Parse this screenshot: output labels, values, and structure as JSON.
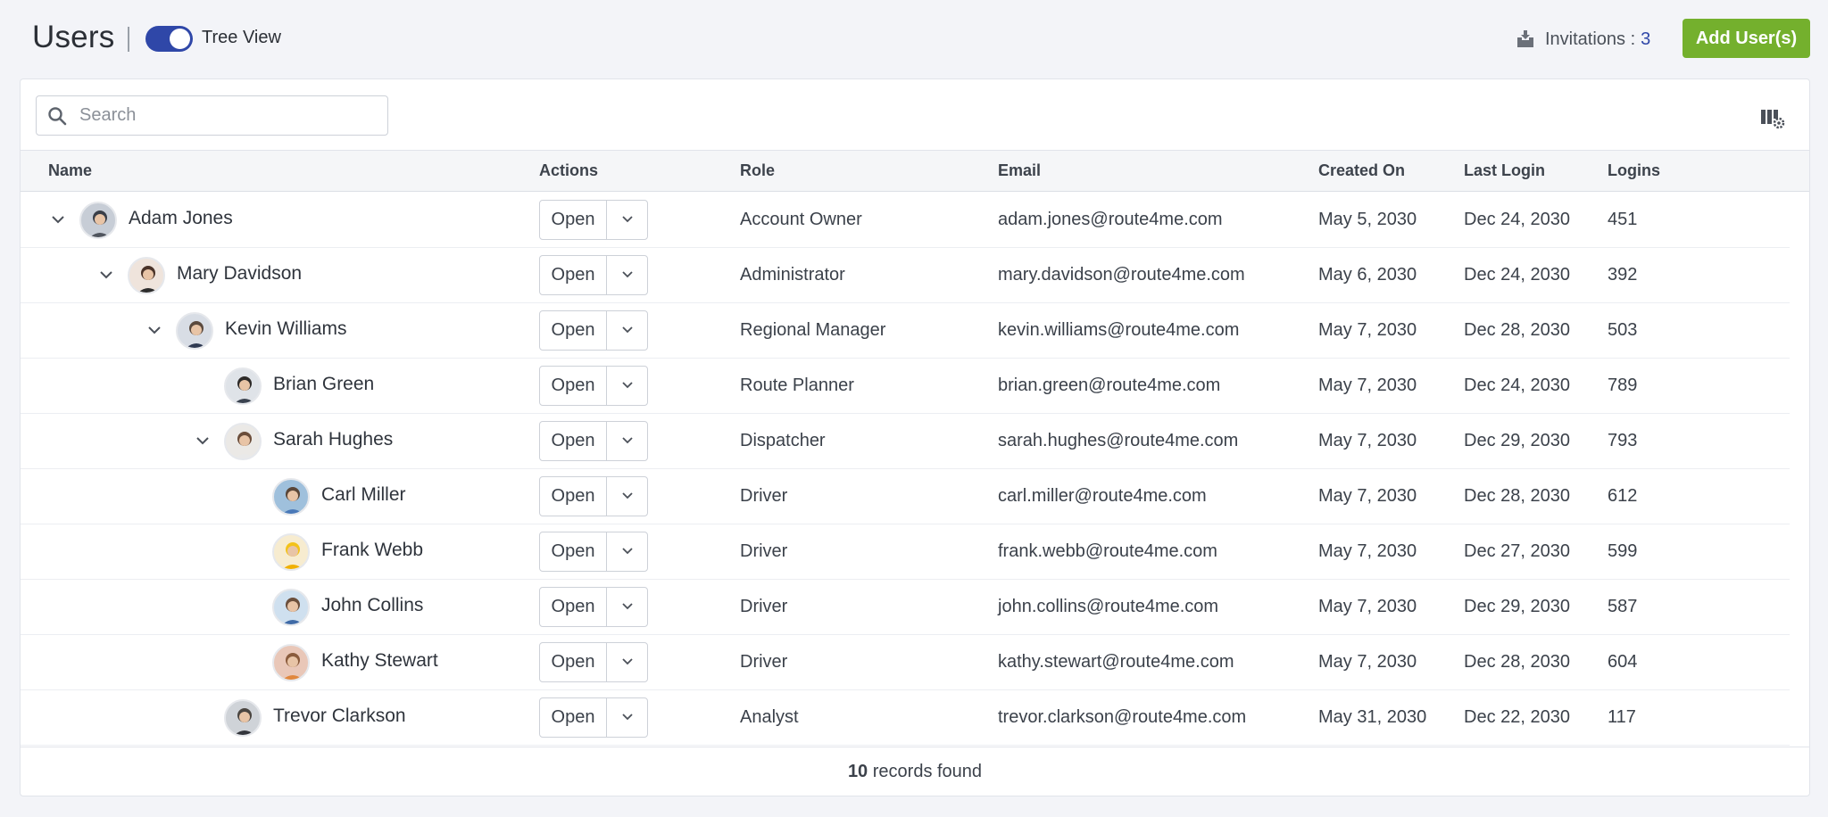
{
  "header": {
    "title": "Users",
    "tree_view_label": "Tree View",
    "tree_view_on": true,
    "invitations_label": "Invitations :",
    "invitations_count": "3",
    "add_button_label": "Add User(s)"
  },
  "colors": {
    "primary": "#2f47a8",
    "accent_green": "#74b02d",
    "background": "#f3f4f8"
  },
  "search": {
    "placeholder": "Search",
    "value": ""
  },
  "table": {
    "columns": [
      "Name",
      "Actions",
      "Role",
      "Email",
      "Created On",
      "Last Login",
      "Logins"
    ],
    "open_label": "Open",
    "rows": [
      {
        "name": "Adam Jones",
        "role": "Account Owner",
        "email": "adam.jones@route4me.com",
        "created": "May 5, 2030",
        "last_login": "Dec 24, 2030",
        "logins": "451",
        "level": 0,
        "expanded": true
      },
      {
        "name": "Mary Davidson",
        "role": "Administrator",
        "email": "mary.davidson@route4me.com",
        "created": "May 6, 2030",
        "last_login": "Dec 24, 2030",
        "logins": "392",
        "level": 1,
        "expanded": true
      },
      {
        "name": "Kevin Williams",
        "role": "Regional Manager",
        "email": "kevin.williams@route4me.com",
        "created": "May 7, 2030",
        "last_login": "Dec 28, 2030",
        "logins": "503",
        "level": 2,
        "expanded": true
      },
      {
        "name": "Brian Green",
        "role": "Route Planner",
        "email": "brian.green@route4me.com",
        "created": "May 7, 2030",
        "last_login": "Dec 24, 2030",
        "logins": "789",
        "level": 3,
        "expanded": false
      },
      {
        "name": "Sarah Hughes",
        "role": "Dispatcher",
        "email": "sarah.hughes@route4me.com",
        "created": "May 7, 2030",
        "last_login": "Dec 29, 2030",
        "logins": "793",
        "level": 3,
        "expanded": true
      },
      {
        "name": "Carl Miller",
        "role": "Driver",
        "email": "carl.miller@route4me.com",
        "created": "May 7, 2030",
        "last_login": "Dec 28, 2030",
        "logins": "612",
        "level": 4,
        "expanded": false
      },
      {
        "name": "Frank Webb",
        "role": "Driver",
        "email": "frank.webb@route4me.com",
        "created": "May 7, 2030",
        "last_login": "Dec 27, 2030",
        "logins": "599",
        "level": 4,
        "expanded": false
      },
      {
        "name": "John Collins",
        "role": "Driver",
        "email": "john.collins@route4me.com",
        "created": "May 7, 2030",
        "last_login": "Dec 29, 2030",
        "logins": "587",
        "level": 4,
        "expanded": false
      },
      {
        "name": "Kathy Stewart",
        "role": "Driver",
        "email": "kathy.stewart@route4me.com",
        "created": "May 7, 2030",
        "last_login": "Dec 28, 2030",
        "logins": "604",
        "level": 4,
        "expanded": false
      },
      {
        "name": "Trevor Clarkson",
        "role": "Analyst",
        "email": "trevor.clarkson@route4me.com",
        "created": "May 31, 2030",
        "last_login": "Dec 22, 2030",
        "logins": "117",
        "level": 3,
        "expanded": false
      }
    ]
  },
  "footer": {
    "count": "10",
    "text": "records found"
  }
}
